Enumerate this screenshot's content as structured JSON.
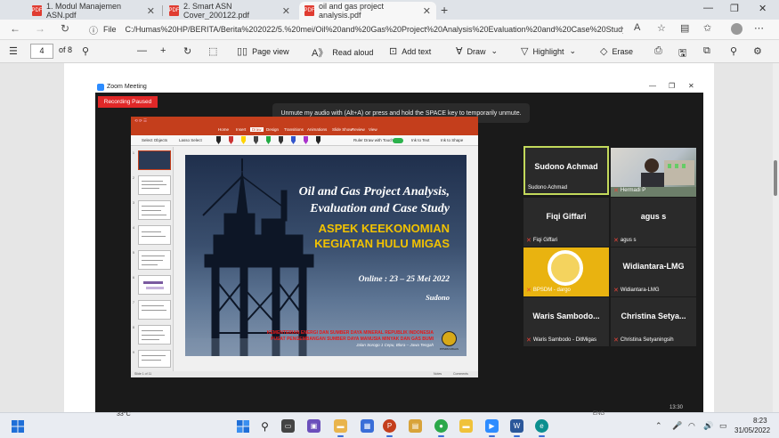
{
  "browser": {
    "tabs": [
      {
        "label": "1. Modul Manajemen ASN.pdf"
      },
      {
        "label": "2. Smart ASN Cover_200122.pdf"
      },
      {
        "label": "oil and gas project analysis.pdf"
      }
    ],
    "address": {
      "info_label": "File",
      "url": "C:/Humas%20HP/BERITA/Berita%202022/5.%20mei/Oil%20and%20Gas%20Project%20Analysis%20Evaluation%20and%20Case%20Study/o..."
    }
  },
  "pdf_toolbar": {
    "page_current": "4",
    "page_total": "of 8",
    "page_view_label": "Page view",
    "read_aloud_label": "Read aloud",
    "add_text_label": "Add text",
    "draw_label": "Draw",
    "highlight_label": "Highlight",
    "erase_label": "Erase"
  },
  "zoom": {
    "title": "Zoom Meeting",
    "recording_label": "Recording Paused",
    "unmute_banner": "Unmute my audio with (Alt+A) or press and hold the SPACE key to temporarily unmute.",
    "ppt": {
      "menu": [
        "Home",
        "Insert",
        "Draw",
        "Design",
        "Transitions",
        "Animations",
        "Slide Show",
        "Review",
        "View"
      ],
      "ribbon": {
        "select": "Select Objects",
        "lasso": "Lasso Select",
        "ruler": "Ruler",
        "draw_touch": "Draw with Touch",
        "ink_text": "Ink to Text",
        "ink_shape": "Ink to Shape"
      },
      "status_left": "Slide 1 of 11",
      "status_notes": "Notes",
      "status_comments": "Comments"
    },
    "slide": {
      "title_line1": "Oil and Gas Project Analysis,",
      "title_line2": "Evaluation and Case Study",
      "subtitle_line1": "ASPEK KEEKONOMIAN",
      "subtitle_line2": "KEGIATAN HULU MIGAS",
      "date": "Online : 23 – 25 Mei 2022",
      "presenter": "Sudono",
      "org_line1": "KEMENTERIAN ENERGI DAN SUMBER DAYA MINERAL REPUBLIK INDONESIA",
      "org_line2": "PUSAT PENGEMBANGAN SUMBER DAYA MANUSIA MINYAK DAN GAS BUMI",
      "org_line3": "Jalan Sorogo 1 Cepu, Blora – Jawa Tengah",
      "emblem_label": "PPSDM MIGAS"
    },
    "participants": [
      {
        "big": "Sudono Achmad",
        "small": "Sudono Achmad"
      },
      {
        "big": "",
        "small": "Hermadi P"
      },
      {
        "big": "Fiqi Giffari",
        "small": "Fiqi Giffari"
      },
      {
        "big": "agus s",
        "small": "agus s"
      },
      {
        "big": "",
        "small": "BPSDM - dargo"
      },
      {
        "big": "Widiantara-LMG",
        "small": "Widiantara-LMG"
      },
      {
        "big": "Waris  Sambodo...",
        "small": "Waris Sambodo - DitMigas"
      },
      {
        "big": "Christina  Setya...",
        "small": "Christina Setyaningsih"
      }
    ],
    "bottom_time": "13:30"
  },
  "taskbar": {
    "weather": "33°C",
    "lang": "ENG",
    "time": "8:23",
    "date": "31/05/2022"
  }
}
